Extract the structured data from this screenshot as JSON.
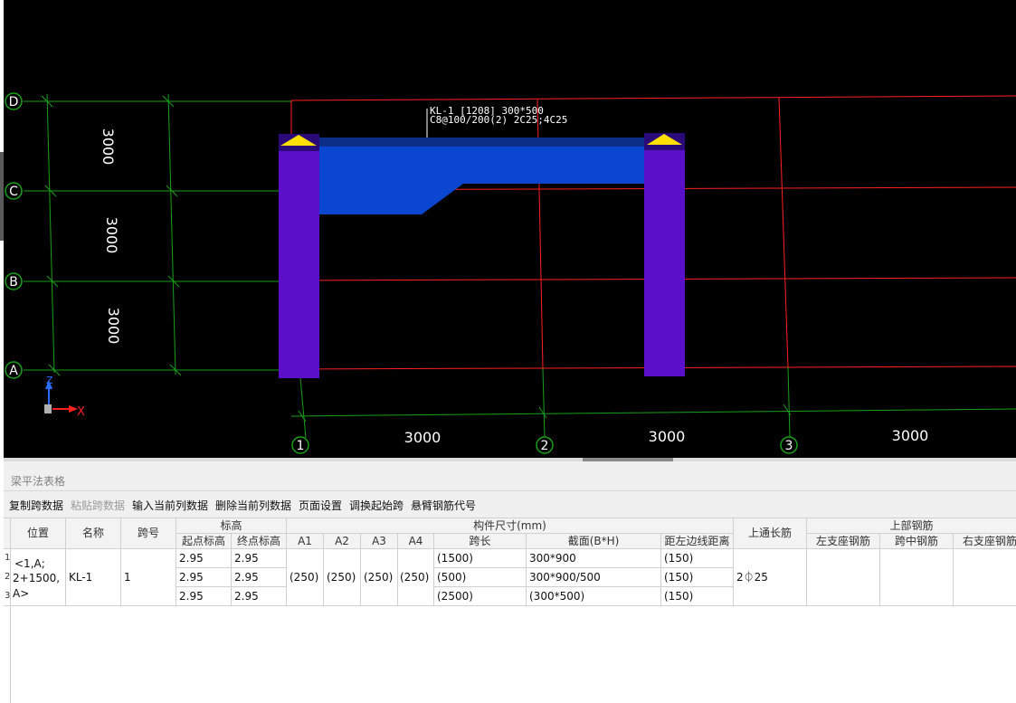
{
  "viewport": {
    "beam_label_line1": "KL-1 [1208] 300*500",
    "beam_label_line2": "C8@100/200(2) 2C25;4C25",
    "axis_rows": [
      "D",
      "C",
      "B",
      "A"
    ],
    "axis_cols": [
      "1",
      "2",
      "3"
    ],
    "vertical_dims": [
      "3000",
      "3000",
      "3000"
    ],
    "horizontal_dims": [
      "3000",
      "3000",
      "3000"
    ],
    "axis_labels": {
      "z": "Z",
      "x": "X"
    },
    "colors": {
      "column": "#5a10c8",
      "beam": "#0b46d0",
      "beam_dark": "#0c2e88",
      "grid_red": "#ff2020",
      "grid_green": "#18a018",
      "support_marker": "#ffe000"
    }
  },
  "panel": {
    "title": "梁平法表格",
    "toolbar": [
      {
        "label": "复制跨数据",
        "enabled": true
      },
      {
        "label": "粘贴跨数据",
        "enabled": false
      },
      {
        "label": "输入当前列数据",
        "enabled": true
      },
      {
        "label": "删除当前列数据",
        "enabled": true
      },
      {
        "label": "页面设置",
        "enabled": true
      },
      {
        "label": "调换起始跨",
        "enabled": true
      },
      {
        "label": "悬臂钢筋代号",
        "enabled": true
      }
    ],
    "table": {
      "headers": {
        "position": "位置",
        "name": "名称",
        "span_no": "跨号",
        "elevation": "标高",
        "start_elev": "起点标高",
        "end_elev": "终点标高",
        "size_group": "构件尺寸(mm)",
        "a1": "A1",
        "a2": "A2",
        "a3": "A3",
        "a4": "A4",
        "span_len": "跨长",
        "section": "截面(B*H)",
        "edge_dist": "距左边线距离",
        "top_through": "上通长筋",
        "top_rebar": "上部钢筋",
        "left_support": "左支座钢筋",
        "mid_span": "跨中钢筋",
        "right_support": "右支座钢筋"
      },
      "position_lines": [
        "<1,A;",
        "2+1500,",
        "A>"
      ],
      "name": "KL-1",
      "span_no": "1",
      "a_values": [
        "(250)",
        "(250)",
        "(250)",
        "(250)"
      ],
      "top_through": "2⏀25",
      "rows": [
        {
          "num": "1",
          "start": "2.95",
          "end": "2.95",
          "span_len": "(1500)",
          "section": "300*900",
          "edge": "(150)"
        },
        {
          "num": "2",
          "start": "2.95",
          "end": "2.95",
          "span_len": "(500)",
          "section": "300*900/500",
          "edge": "(150)"
        },
        {
          "num": "3",
          "start": "2.95",
          "end": "2.95",
          "span_len": "(2500)",
          "section": "(300*500)",
          "edge": "(150)"
        }
      ]
    }
  }
}
